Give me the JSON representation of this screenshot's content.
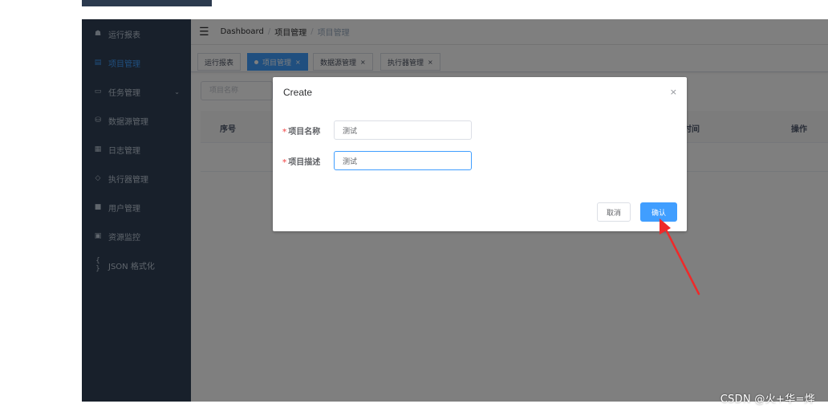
{
  "sidebar": {
    "items": [
      {
        "icon": "dashboard-icon",
        "glyph": "☗",
        "label": "运行报表"
      },
      {
        "icon": "project-icon",
        "glyph": "▤",
        "label": "项目管理",
        "active": true
      },
      {
        "icon": "task-icon",
        "glyph": "▭",
        "label": "任务管理",
        "caret": "⌄"
      },
      {
        "icon": "datasource-icon",
        "glyph": "⛁",
        "label": "数据源管理"
      },
      {
        "icon": "log-icon",
        "glyph": "▦",
        "label": "日志管理"
      },
      {
        "icon": "executor-icon",
        "glyph": "◇",
        "label": "执行器管理"
      },
      {
        "icon": "user-icon",
        "glyph": "■",
        "label": "用户管理"
      },
      {
        "icon": "monitor-icon",
        "glyph": "▣",
        "label": "资源监控"
      },
      {
        "icon": "json-icon",
        "glyph": "{ }",
        "label": "JSON 格式化"
      }
    ]
  },
  "navbar": {
    "breadcrumb": [
      "Dashboard",
      "项目管理",
      "项目管理"
    ],
    "separator": "/"
  },
  "tags": [
    {
      "label": "运行报表",
      "active": false,
      "close": ""
    },
    {
      "label": "项目管理",
      "active": true,
      "close": "×"
    },
    {
      "label": "数据源管理",
      "active": false,
      "close": "×"
    },
    {
      "label": "执行器管理",
      "active": false,
      "close": "×"
    }
  ],
  "search": {
    "placeholder": "项目名称"
  },
  "table": {
    "headers": {
      "index": "序号",
      "time": "时间",
      "actions": "操作"
    }
  },
  "dialog": {
    "title": "Create",
    "close": "×",
    "fields": {
      "name": {
        "required_mark": "*",
        "label": "项目名称",
        "value": "测试"
      },
      "desc": {
        "required_mark": "*",
        "label": "项目描述",
        "value": "测试"
      }
    },
    "cancel_label": "取消",
    "confirm_label": "确认"
  },
  "annotation": {
    "color": "#ee2a2a"
  },
  "watermark": "CSDN @火+华=烨",
  "colors": {
    "primary": "#409eff",
    "sidebar": "#304156",
    "required": "#f56c6c"
  }
}
